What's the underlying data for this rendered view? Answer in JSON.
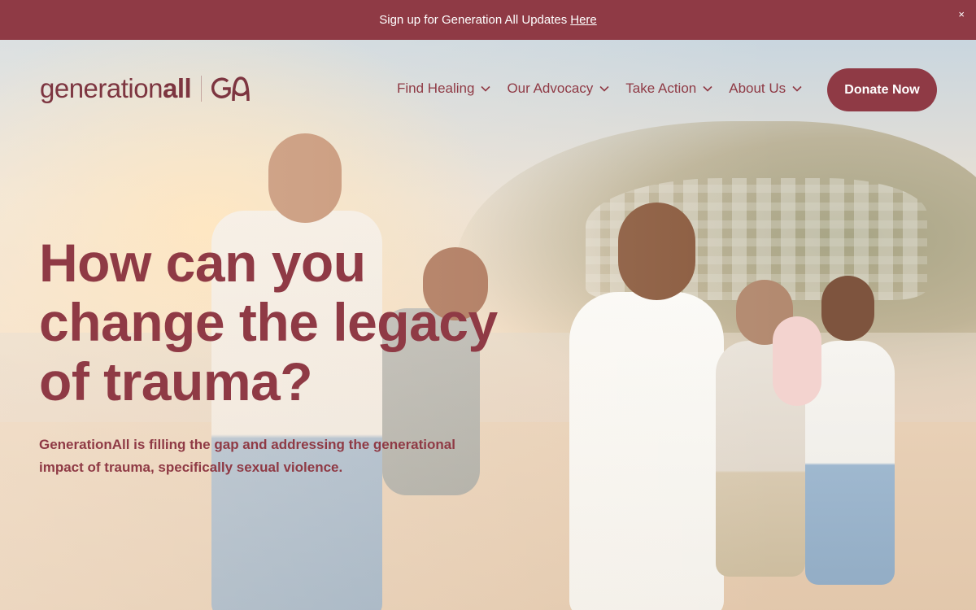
{
  "announcement": {
    "text": "Sign up for Generation All Updates",
    "link_label": "Here",
    "close_label": "×"
  },
  "header": {
    "logo": {
      "text_regular": "generation",
      "text_bold": "all",
      "mark": "GA"
    },
    "nav": [
      {
        "label": "Find Healing",
        "icon": "chevron-down-icon"
      },
      {
        "label": "Our Advocacy",
        "icon": "chevron-down-icon"
      },
      {
        "label": "Take Action",
        "icon": "chevron-down-icon"
      },
      {
        "label": "About Us",
        "icon": "chevron-down-icon"
      }
    ],
    "donate_label": "Donate Now"
  },
  "hero": {
    "headline": "How can you change the legacy of trauma?",
    "subtext": "GenerationAll is filling the gap and addressing the generational impact of trauma, specifically sexual violence."
  },
  "colors": {
    "brand": "#8f3a45",
    "logo": "#7d3540",
    "announcement_bg": "#8f3a45"
  }
}
